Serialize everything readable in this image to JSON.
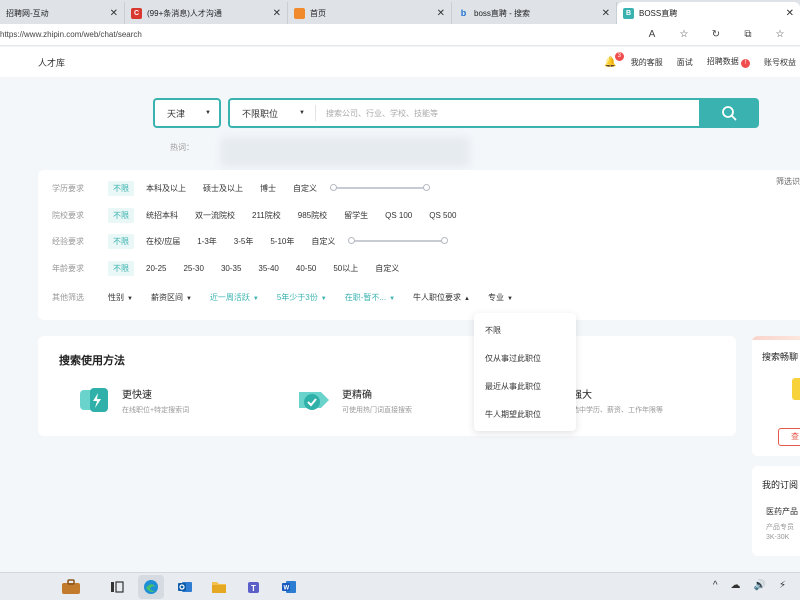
{
  "browser": {
    "tabs": [
      {
        "title": "招聘网-互动",
        "color": "#6b7a8f",
        "glyph": ""
      },
      {
        "title": "(99+条消息)人才沟通",
        "color": "#d9382f",
        "glyph": "C"
      },
      {
        "title": "首页",
        "color": "#f08a2c",
        "glyph": ""
      },
      {
        "title": "boss直聘 - 搜索",
        "color": "#ffffff",
        "glyph": "b"
      },
      {
        "title": "BOSS直聘",
        "color": "#3ab3b0",
        "glyph": "B"
      }
    ],
    "url": "https://www.zhipin.com/web/chat/search",
    "read_aloud": "A",
    "star_icon": "☆",
    "refresh_icon": "↻",
    "split_icon": "⧉",
    "fav_icon": "☆"
  },
  "header": {
    "brand": "人才库",
    "notify_count": "3",
    "links": [
      "我的客服",
      "面试"
    ],
    "recruit_data": "招聘数据",
    "recruit_badge": "!",
    "account": "账号权益"
  },
  "search": {
    "city": "天津",
    "job": "不限职位",
    "placeholder": "搜索公司、行业、学校、技能等",
    "hot_label": "热词："
  },
  "filters": {
    "screen_label": "筛选识",
    "education": {
      "label": "学历要求",
      "options": [
        "不限",
        "本科及以上",
        "硕士及以上",
        "博士",
        "自定义"
      ]
    },
    "school": {
      "label": "院校要求",
      "options": [
        "不限",
        "统招本科",
        "双一流院校",
        "211院校",
        "985院校",
        "留学生",
        "QS 100",
        "QS 500"
      ]
    },
    "experience": {
      "label": "经验要求",
      "options": [
        "不限",
        "在校/应届",
        "1-3年",
        "3-5年",
        "5-10年",
        "自定义"
      ]
    },
    "age": {
      "label": "年龄要求",
      "options": [
        "不限",
        "20-25",
        "25-30",
        "30-35",
        "35-40",
        "40-50",
        "50以上",
        "自定义"
      ]
    },
    "other": {
      "label": "其他筛选",
      "dropdowns": [
        {
          "label": "性别",
          "active": false,
          "caret": "▼"
        },
        {
          "label": "薪资区间",
          "active": false,
          "caret": "▼"
        },
        {
          "label": "近一周活跃",
          "active": true,
          "caret": "▼"
        },
        {
          "label": "5年少于3份",
          "active": true,
          "caret": "▼"
        },
        {
          "label": "在职-暂不...",
          "active": true,
          "caret": "▼"
        },
        {
          "label": "牛人职位要求",
          "active": false,
          "caret": "▲"
        },
        {
          "label": "专业",
          "active": false,
          "caret": "▼"
        }
      ]
    },
    "job_requirement_menu": [
      "不限",
      "仅从事过此职位",
      "最近从事此职位",
      "牛人期望此职位"
    ]
  },
  "usage": {
    "title": "搜索使用方法",
    "features": [
      {
        "title": "更快速",
        "desc": "在线职位+特定搜索词"
      },
      {
        "title": "更精确",
        "desc": "可使用热门词直接搜索"
      },
      {
        "title": "强大",
        "desc": "选中学历、薪资、工作年限等"
      }
    ]
  },
  "side": {
    "card1_title": "搜索畅聊",
    "card1_button": "查",
    "card2_title": "我的订阅",
    "card2_item": "医药产品",
    "card2_sub1": "产品专员",
    "card2_sub2": "3K-30K"
  },
  "taskbar": {
    "teams_badge": "T",
    "tray": [
      "^",
      "☁",
      "🔊",
      "⚡"
    ]
  },
  "colors": {
    "accent": "#3ab3b0",
    "badge": "#f04e4e"
  }
}
